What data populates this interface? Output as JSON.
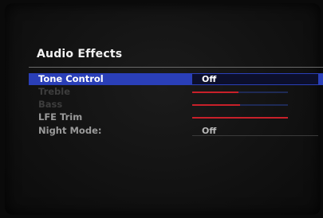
{
  "menu": {
    "title": "Audio Effects",
    "items": [
      {
        "label": "Tone Control",
        "type": "option",
        "value": "Off",
        "state": "selected"
      },
      {
        "label": "Treble",
        "type": "slider",
        "level": 0.48,
        "state": "disabled"
      },
      {
        "label": "Bass",
        "type": "slider",
        "level": 0.5,
        "state": "disabled"
      },
      {
        "label": "LFE Trim",
        "type": "slider",
        "level": 1.0,
        "state": "normal"
      },
      {
        "label": "Night Mode:",
        "type": "option",
        "value": "Off",
        "state": "normal"
      }
    ]
  },
  "colors": {
    "highlight": "#2a3fb8",
    "slider_fill": "#c8202a",
    "slider_track": "#1e2a55"
  }
}
